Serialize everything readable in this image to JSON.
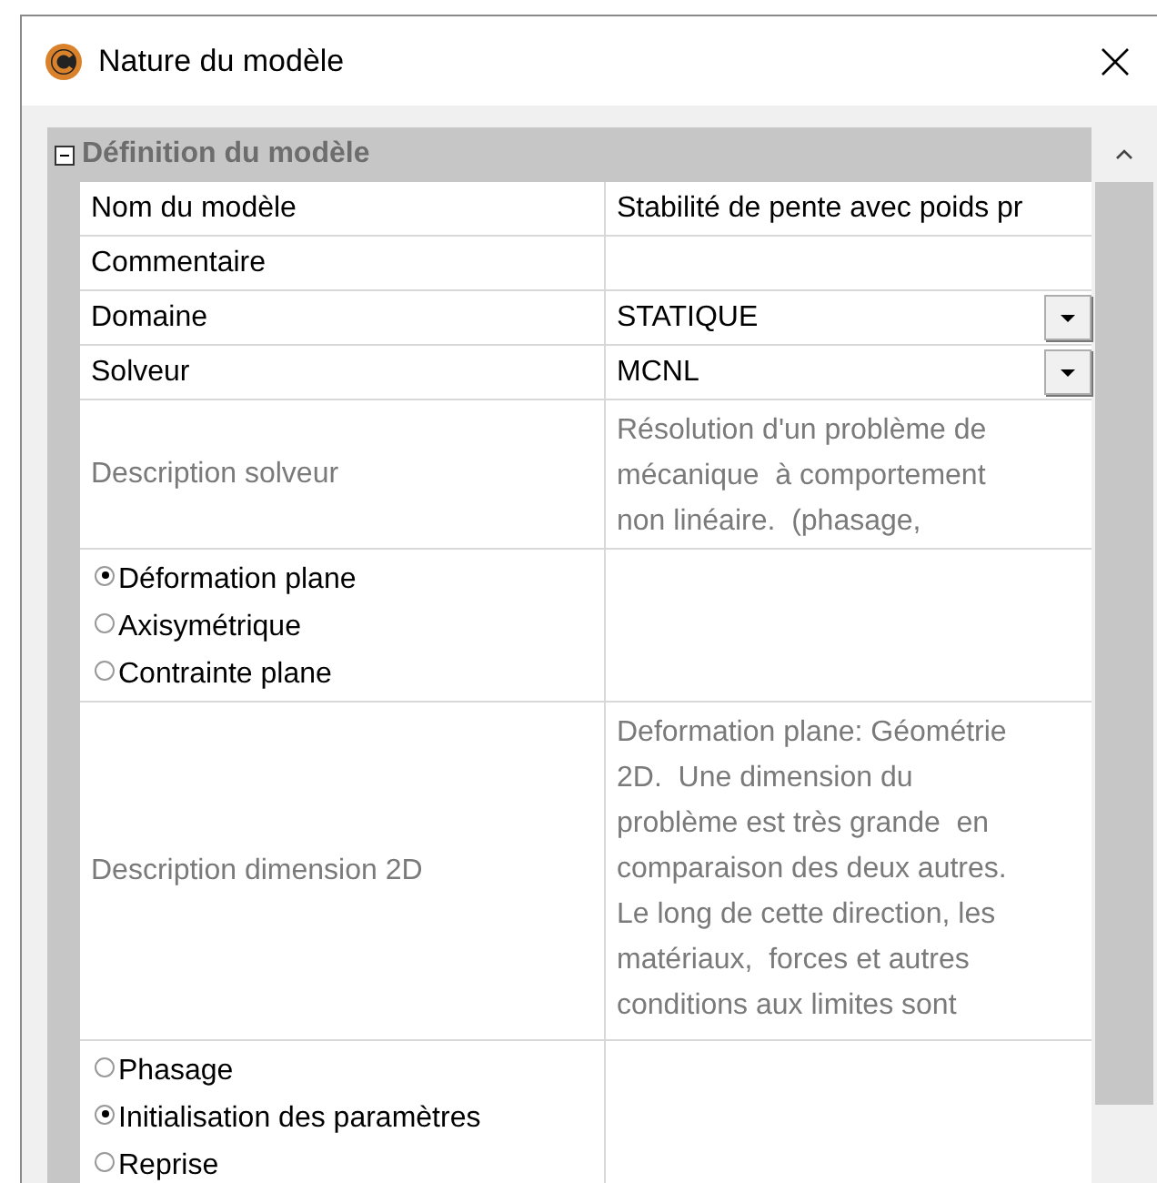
{
  "window": {
    "title": "Nature du modèle"
  },
  "category": {
    "title": "Définition du modèle",
    "expanded": true
  },
  "properties": [
    {
      "kind": "text",
      "name": "Nom du modèle",
      "value": "Stabilité de pente avec poids pr"
    },
    {
      "kind": "text",
      "name": "Commentaire"
    },
    {
      "kind": "dropdown",
      "name": "Domaine",
      "value": "STATIQUE"
    },
    {
      "kind": "dropdown",
      "name": "Solveur",
      "value": "MCNL"
    },
    {
      "kind": "description",
      "name": "Description solveur",
      "lines": [
        "Résolution d'un problème de",
        "mécanique  à comportement",
        "non linéaire.  (phasage,"
      ]
    },
    {
      "kind": "radio",
      "options": [
        {
          "label": "Déformation plane",
          "selected": true
        },
        {
          "label": "Axisymétrique",
          "selected": false
        },
        {
          "label": "Contrainte plane",
          "selected": false
        }
      ]
    },
    {
      "kind": "description",
      "name": "Description dimension 2D",
      "lines": [
        "Deformation plane: Géométrie",
        "2D.  Une dimension du",
        "problème est très grande  en",
        "comparaison des deux autres.",
        "Le long de cette direction, les",
        "matériaux,  forces et autres",
        "conditions aux limites sont"
      ]
    },
    {
      "kind": "radio",
      "options": [
        {
          "label": "Phasage",
          "selected": false
        },
        {
          "label": "Initialisation des paramètres",
          "selected": true
        },
        {
          "label": "Reprise",
          "selected": false
        }
      ]
    }
  ]
}
